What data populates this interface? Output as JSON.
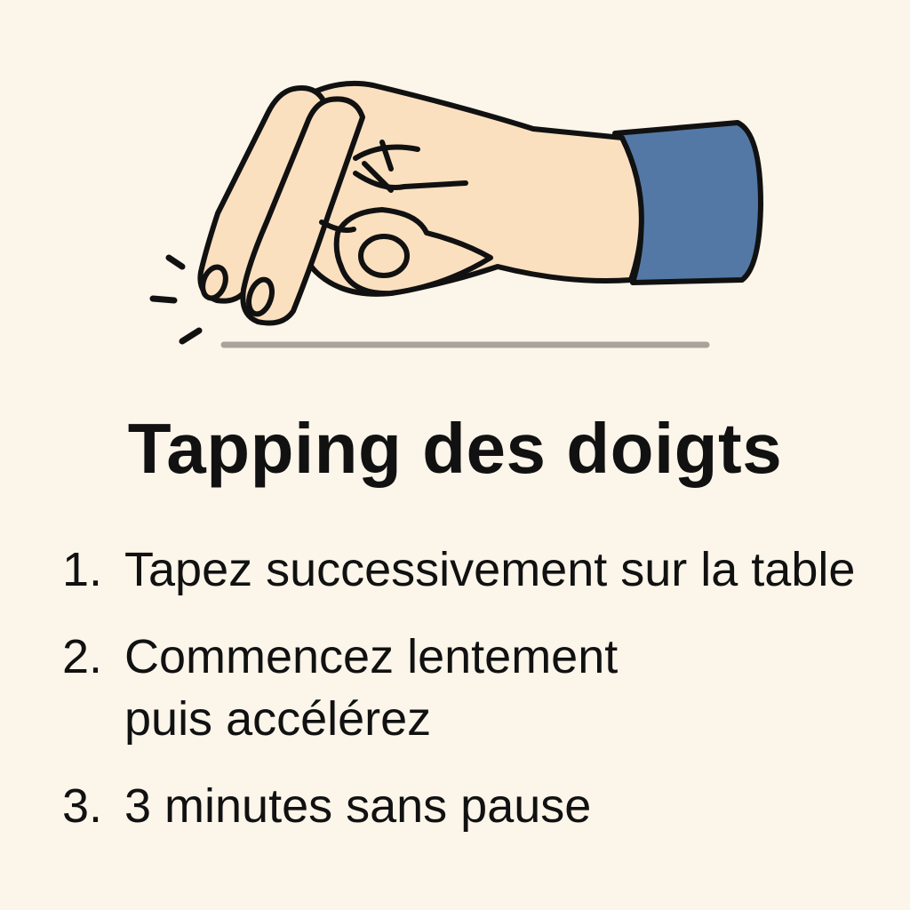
{
  "title": "Tapping des doigts",
  "steps": [
    {
      "number": "1.",
      "text": "Tapez successivement sur la table"
    },
    {
      "number": "2.",
      "text": "Commencez lentement\npuis accélérez"
    },
    {
      "number": "3.",
      "text": "3 minutes sans pause"
    }
  ],
  "colors": {
    "background": "#fbf5ea",
    "skin": "#fbe0c0",
    "sleeve": "#5378a5",
    "table_line": "#a8a49c",
    "outline": "#111111"
  },
  "icons": [
    "tapping-hand-icon",
    "tap-motion-lines-icon"
  ]
}
